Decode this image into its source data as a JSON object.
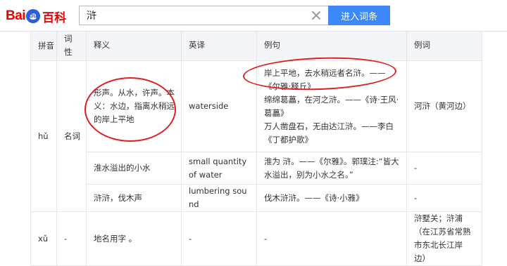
{
  "header": {
    "logo_bai": "Bai",
    "logo_du": "du",
    "logo_baike": "百科",
    "search_value": "浒",
    "enter_button_label": "进入词条"
  },
  "table": {
    "headers": {
      "pinyin": "拼音",
      "pos": "词性",
      "definition": "释义",
      "english": "英译",
      "example_sentence": "例句",
      "example_word": "例词"
    },
    "rows": [
      {
        "pinyin": "hǔ",
        "pos": "名词",
        "definition": "形声。从水，许声。本义：水边，指离水稍远的岸上平地",
        "english": "waterside",
        "examples": [
          "岸上平地，去水稍远者名浒。——《尔雅·释丘》",
          "绵绵葛藟，在河之浒。——《诗·王风·葛藟》",
          "万人凿盘石，无由达江浒。——李白《丁都护歌》"
        ],
        "example_word": "河浒（黄河边）"
      },
      {
        "definition": "淮水溢出的小水",
        "english": "small quantity of water",
        "examples": [
          "淮为 浒。——《尔雅》。郭璞注:“皆大水溢出，别为小水之名。”"
        ],
        "example_word": "-"
      },
      {
        "definition": "浒浒，伐木声",
        "english": "lumbering sound",
        "examples": [
          "伐木浒浒。——《诗·小雅》"
        ],
        "example_word": "-"
      },
      {
        "pinyin": "xǔ",
        "pos": "-",
        "definition": "地名用字 。",
        "english": "-",
        "examples": [
          "-"
        ],
        "example_word": "浒墅关；浒浦（在江苏省常熟市东北长江岸边）"
      }
    ]
  },
  "annotations": {
    "circle_color": "#e11d1d"
  }
}
